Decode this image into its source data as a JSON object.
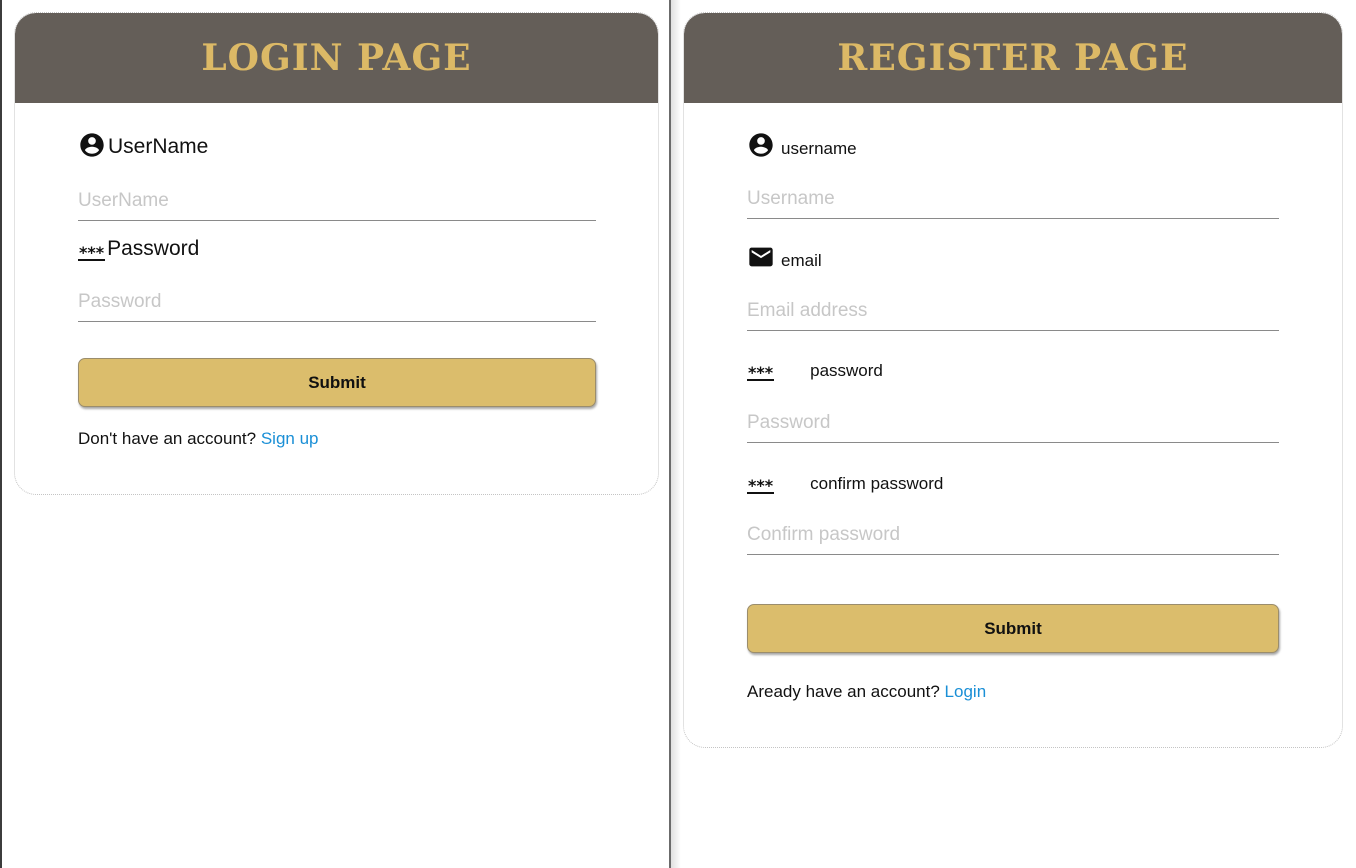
{
  "login": {
    "title": "LOGIN PAGE",
    "username_label": "UserName",
    "username_placeholder": "UserName",
    "password_icon": "***",
    "password_label": "Password",
    "password_placeholder": "Password",
    "submit_label": "Submit",
    "footer_text": "Don't have an account?",
    "footer_link": "Sign up"
  },
  "register": {
    "title": "REGISTER PAGE",
    "username_label": "username",
    "username_placeholder": "Username",
    "email_label": "email",
    "email_placeholder": "Email address",
    "password_icon": "***",
    "password_label": "password",
    "password_placeholder": "Password",
    "confirm_icon": "***",
    "confirm_label": "confirm password",
    "confirm_placeholder": "Confirm password",
    "submit_label": "Submit",
    "footer_text": "Aready have an account?",
    "footer_link": "Login"
  },
  "icons": {
    "user": "account-circle-icon",
    "email": "mail-icon",
    "password": "password-icon"
  },
  "colors": {
    "header_bg": "#645e58",
    "title_gold": "#dcb966",
    "button_gold": "#dbbd6c",
    "link_blue": "#1a8fd6"
  }
}
